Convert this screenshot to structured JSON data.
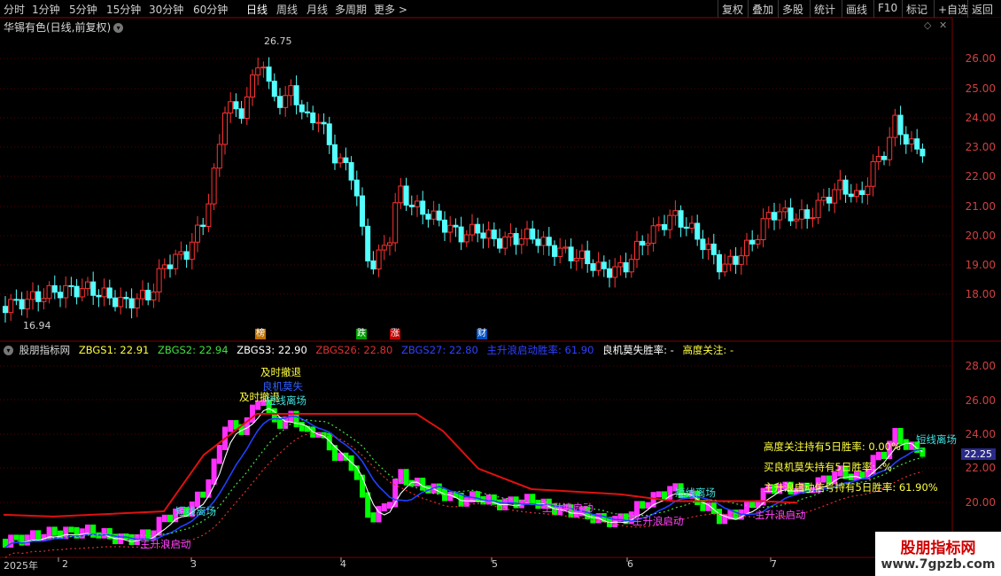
{
  "toolbar": {
    "timeframes": [
      "分时",
      "1分钟",
      "5分钟",
      "15分钟",
      "30分钟",
      "60分钟",
      "日线",
      "周线",
      "月线",
      "多周期",
      "更多 >"
    ],
    "active_index": 6,
    "buttons": [
      "复权",
      "叠加",
      "多股",
      "统计",
      "画线",
      "F10",
      "标记",
      "+自选",
      "返回"
    ]
  },
  "main_pane": {
    "title": "华锡有色(日线,前复权)",
    "high_label": "26.75",
    "low_label": "16.94",
    "y_ticks": [
      "26.00",
      "25.00",
      "24.00",
      "23.00",
      "22.00",
      "21.00",
      "20.00",
      "19.00",
      "18.00"
    ],
    "markers": [
      {
        "text": "榜",
        "color": "#c07000"
      },
      {
        "text": "跌",
        "color": "#00a000"
      },
      {
        "text": "涨",
        "color": "#c00000"
      },
      {
        "text": "财",
        "color": "#0050c0"
      }
    ]
  },
  "indicator_pane": {
    "name": "股朋指标网",
    "values": [
      {
        "text": "ZBGS1: 22.91",
        "color": "#ffff40"
      },
      {
        "text": "ZBGS2: 22.94",
        "color": "#40e040"
      },
      {
        "text": "ZBGS3: 22.90",
        "color": "#ffffff"
      },
      {
        "text": "ZBGS26: 22.80",
        "color": "#e03030"
      },
      {
        "text": "ZBGS27: 22.80",
        "color": "#3040ff"
      },
      {
        "text": "主升浪启动胜率: 61.90",
        "color": "#3040ff"
      },
      {
        "text": "良机莫失胜率: -",
        "color": "#ffffff"
      },
      {
        "text": "高度关注: -",
        "color": "#ffff40"
      }
    ],
    "y_ticks": [
      "28.00",
      "26.00",
      "24.00",
      "22.00",
      "20.00"
    ],
    "current_price": "22.25",
    "stats": [
      {
        "text": "高度关注持有5日胜率: 0.00%",
        "color": "#ffff40"
      },
      {
        "text": "买良机莫失持有5日胜率: -%",
        "color": "#ffff40"
      },
      {
        "text": "主升浪启动信号持有5日胜率: 61.90%",
        "color": "#ffff40"
      }
    ],
    "annotations": [
      {
        "text": "及时撤退",
        "color": "#ffff40"
      },
      {
        "text": "及时撤退",
        "color": "#ffff40"
      },
      {
        "text": "良机莫失",
        "color": "#3060ff"
      },
      {
        "text": "短线离场",
        "color": "#40e0e0"
      },
      {
        "text": "短线离场",
        "color": "#40e0e0"
      },
      {
        "text": "短线离场",
        "color": "#40e0e0"
      },
      {
        "text": "短线离场",
        "color": "#40e0e0"
      },
      {
        "text": "主升浪启动",
        "color": "#ff40ff"
      },
      {
        "text": "主升浪启动",
        "color": "#ff40ff"
      },
      {
        "text": "主升浪启动",
        "color": "#ff40ff"
      },
      {
        "text": "主升浪启动",
        "color": "#ff40ff"
      }
    ]
  },
  "dates": [
    "2025年",
    "2",
    "3",
    "4",
    "5",
    "6",
    "7"
  ],
  "watermark": {
    "line1": "股朋指标网",
    "line2": "www.7gpzb.com"
  },
  "colors": {
    "up": "#ff3333",
    "down": "#54ffff",
    "grid": "#5a0000",
    "ind_up": "#ff30ff",
    "ind_down": "#00ff00"
  }
}
